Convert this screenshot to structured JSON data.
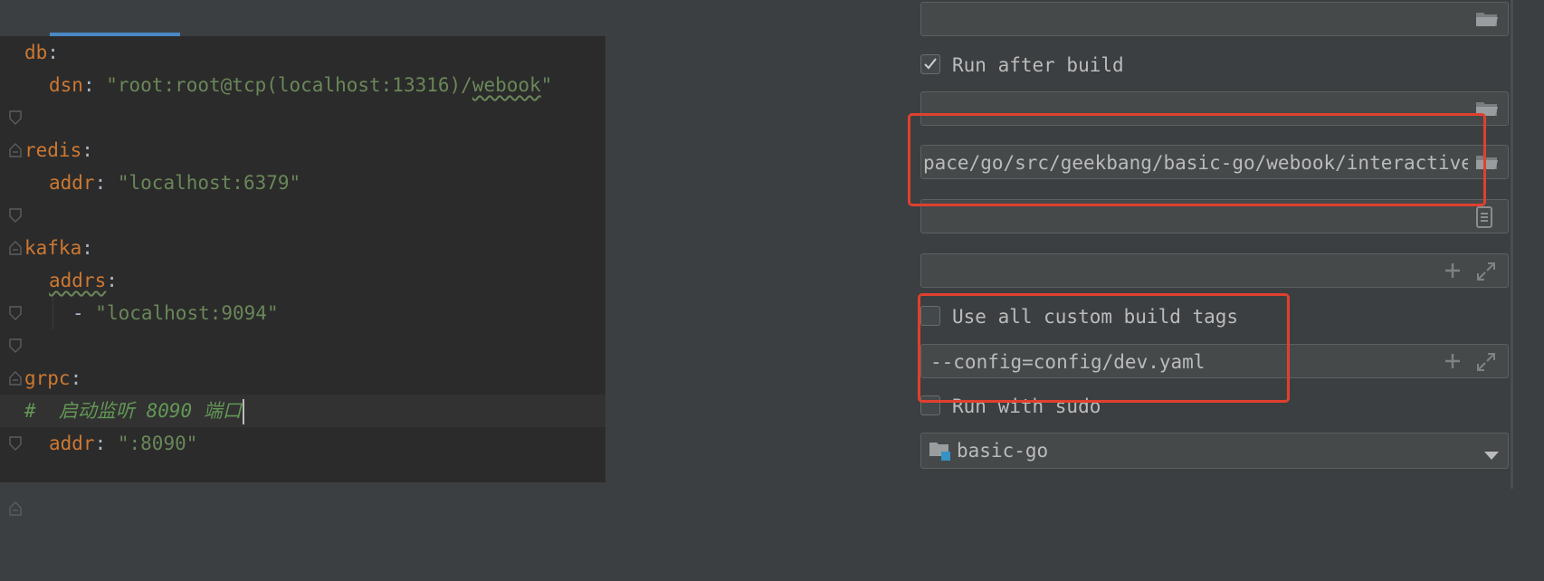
{
  "editor": {
    "lines": [
      {
        "k": "db",
        "p": ":"
      },
      {
        "k": "dsn",
        "p": ": ",
        "s1": "\"root:root@tcp(localhost:13316)/",
        "s2": "webook",
        "s3": "\""
      },
      {
        "k": "redis",
        "p": ":"
      },
      {
        "k": "addr",
        "p": ": ",
        "s": "\"localhost:6379\""
      },
      {
        "k": "kafka",
        "p": ":"
      },
      {
        "k": "addrs",
        "p": ":"
      },
      {
        "p": "- ",
        "s": "\"localhost:9094\""
      },
      {
        "k": "grpc",
        "p": ":"
      },
      {
        "c": "#  启动监听 8090 端口"
      },
      {
        "k": "addr",
        "p": ": ",
        "s": "\":8090\""
      }
    ]
  },
  "config": {
    "run_after_build_label": "Run after build",
    "run_after_build_checked": true,
    "working_dir_value": "pace/go/src/geekbang/basic-go/webook/interactive",
    "custom_tags_label": "Use all custom build tags",
    "custom_tags_checked": false,
    "program_args_value": "--config=config/dev.yaml",
    "run_with_sudo_label": "Run with sudo",
    "run_with_sudo_checked": false,
    "module_value": "basic-go"
  },
  "icons": {
    "folder": "folder-icon",
    "document": "document-icon",
    "add": "plus-icon",
    "expand": "expand-icon",
    "dropdown": "chevron-down-icon",
    "fold": "fold-marker-icon"
  },
  "colors": {
    "annotation": "#e0402e",
    "keyword": "#cc7832",
    "string": "#6a8759",
    "comment": "#629755"
  }
}
